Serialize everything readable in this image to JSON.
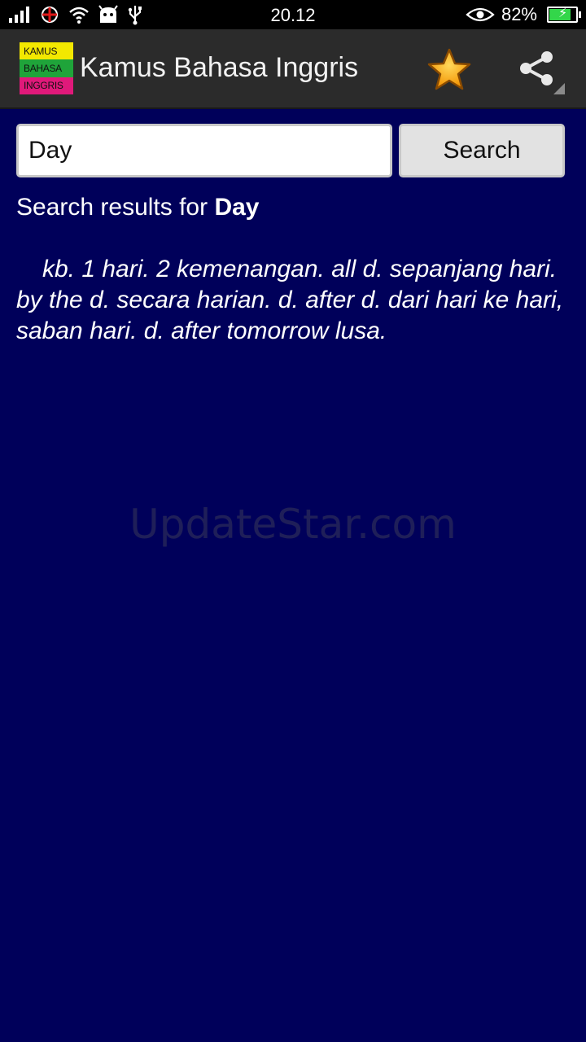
{
  "status_bar": {
    "time": "20.12",
    "battery_percent": "82%",
    "battery_level": 0.82,
    "icons": [
      "signal-icon",
      "app-notification-icon",
      "wifi-icon",
      "android-icon",
      "usb-icon",
      "eye-icon",
      "battery-charging-icon"
    ]
  },
  "action_bar": {
    "logo_lines": [
      "KAMUS",
      "BAHASA",
      "INGGRIS"
    ],
    "logo_colors": [
      "#f3e800",
      "#1fa43a",
      "#e0197a"
    ],
    "title": "Kamus Bahasa Inggris",
    "favorite_icon": "star-icon",
    "share_icon": "share-icon"
  },
  "search": {
    "value": "Day",
    "button_label": "Search"
  },
  "results": {
    "prefix": "Search results for ",
    "term": "Day",
    "definition": "kb. 1 hari. 2 kemenangan. all d. sepanjang hari. by the d. secara harian. d. after d. dari hari ke hari, saban hari. d. after tomorrow lusa."
  },
  "watermark": "UpdateStar.com",
  "colors": {
    "background": "#00005a",
    "action_bar": "#2b2b2b",
    "star": "#f7a21b"
  }
}
